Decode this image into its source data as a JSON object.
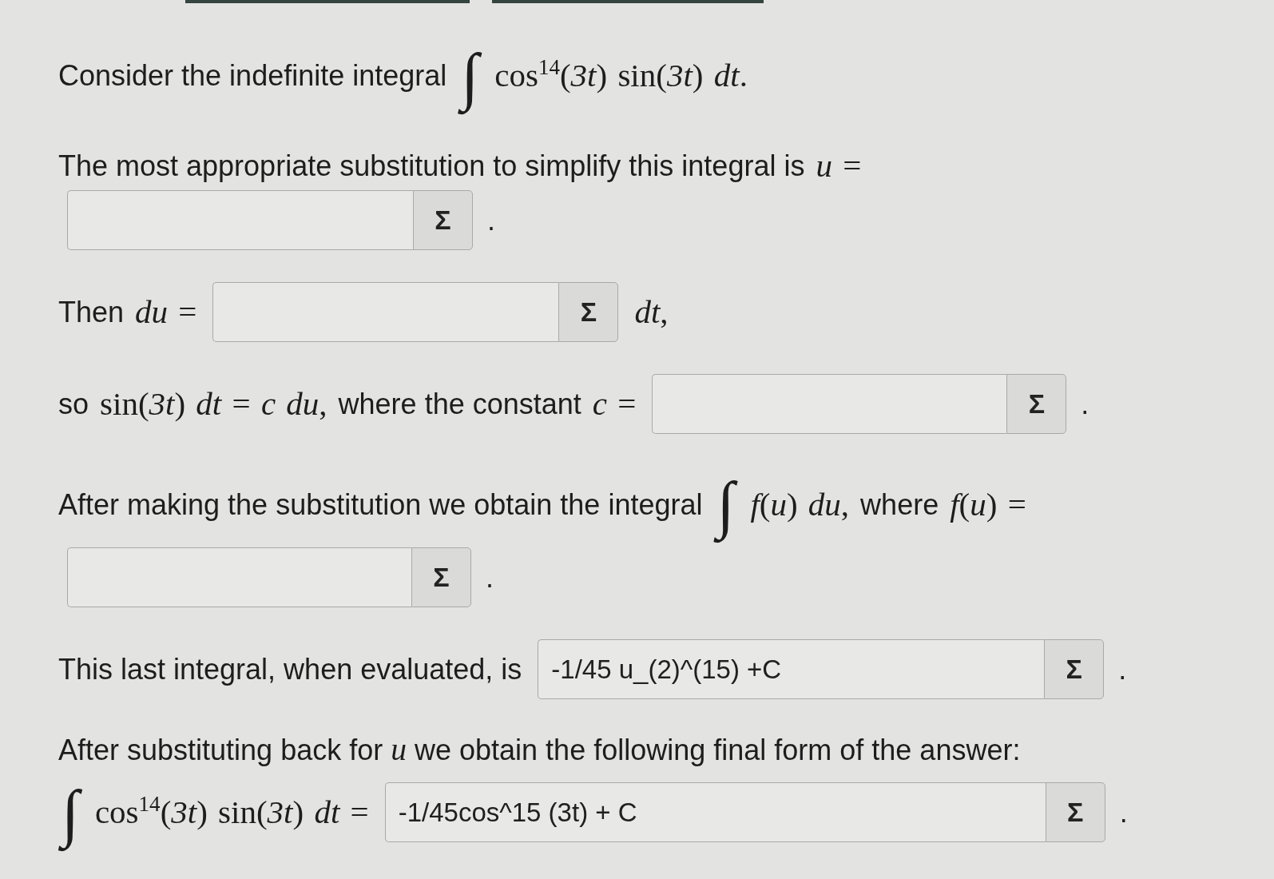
{
  "paragraphs": [
    {
      "lines": [
        [
          {
            "kind": "text",
            "text": "Consider the indefinite integral"
          },
          {
            "kind": "integral",
            "text": "∫"
          },
          {
            "kind": "math",
            "text": "cos$^{14}$(*3t*) sin(*3t*) *dt*."
          }
        ]
      ]
    },
    {
      "lines": [
        [
          {
            "kind": "text",
            "text": "The most appropriate substitution to simplify this integral is"
          },
          {
            "kind": "math",
            "text": "*u* ="
          }
        ],
        [
          {
            "kind": "answer",
            "button": "Σ"
          },
          {
            "kind": "punctuation",
            "text": "."
          }
        ]
      ]
    },
    {
      "lines": [
        [
          {
            "kind": "text",
            "text": "Then"
          },
          {
            "kind": "math",
            "text": "*du* ="
          },
          {
            "kind": "answer",
            "button": "Σ"
          },
          {
            "kind": "math",
            "text": "*dt*,"
          }
        ]
      ]
    },
    {
      "lines": [
        [
          {
            "kind": "text",
            "text": "so"
          },
          {
            "kind": "math",
            "text": "sin(*3t*) *dt* = *c du*,"
          },
          {
            "kind": "text",
            "text": "where the constant"
          },
          {
            "kind": "math",
            "text": "*c* ="
          },
          {
            "kind": "answer",
            "button": "Σ"
          },
          {
            "kind": "punctuation",
            "text": "."
          }
        ]
      ]
    },
    {
      "lines": [
        [
          {
            "kind": "text",
            "text": "After making the substitution we obtain the integral"
          },
          {
            "kind": "integral",
            "text": "∫"
          },
          {
            "kind": "math",
            "text": "*f*(*u*) *du*,"
          },
          {
            "kind": "text",
            "text": "where"
          },
          {
            "kind": "math",
            "text": "*f*(*u*) ="
          }
        ],
        [
          {
            "kind": "answer",
            "button": "Σ"
          },
          {
            "kind": "punctuation",
            "text": "."
          }
        ]
      ]
    },
    {
      "lines": [
        [
          {
            "kind": "text",
            "text": "This last integral, when evaluated, is"
          },
          {
            "kind": "answer",
            "value": "-1/45 u_(2)^(15) +C",
            "button": "Σ"
          },
          {
            "kind": "punctuation",
            "text": "."
          }
        ]
      ]
    },
    {
      "lines": [
        [
          {
            "kind": "text",
            "text": "After substituting back for *u* we obtain the following final form of the answer:"
          }
        ],
        [
          {
            "kind": "integral",
            "text": "∫"
          },
          {
            "kind": "math",
            "text": "cos$^{14}$(*3t*) sin(*3t*) *dt* ="
          },
          {
            "kind": "answer",
            "value": "-1/45cos^15 (3t) + C",
            "button": "Σ"
          },
          {
            "kind": "punctuation",
            "text": "."
          }
        ]
      ]
    }
  ]
}
